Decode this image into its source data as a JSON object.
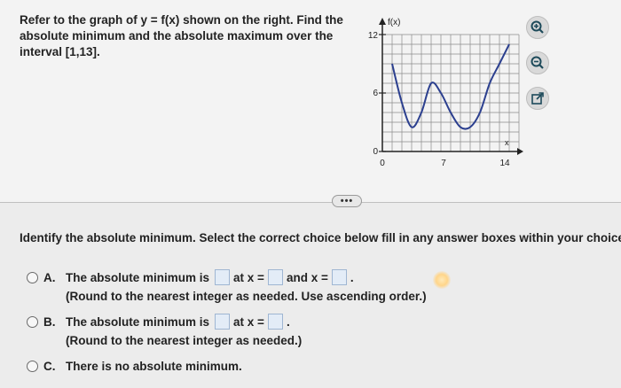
{
  "question": {
    "prompt_lines": [
      "Refer to the graph of y = f(x) shown on the right. Find the",
      "absolute minimum and the absolute maximum over the",
      "interval [1,13]."
    ]
  },
  "graph": {
    "y_axis_label": "f(x)",
    "x_axis_label": "x",
    "y_tick_labels": [
      "12",
      "6",
      "0"
    ],
    "x_tick_labels": [
      "0",
      "7",
      "14"
    ]
  },
  "chart_data": {
    "type": "line",
    "xlabel": "x",
    "ylabel": "f(x)",
    "xlim": [
      0,
      14
    ],
    "ylim": [
      0,
      12
    ],
    "grid": true,
    "x": [
      1,
      2,
      3,
      4,
      5,
      6,
      7,
      8,
      9,
      10,
      11,
      12,
      13
    ],
    "values": [
      9,
      5,
      2.5,
      4,
      7,
      6,
      4,
      2.5,
      2.5,
      4,
      7,
      9,
      11
    ]
  },
  "tools": {
    "zoom_in_icon": "zoom-in-icon",
    "zoom_out_icon": "zoom-out-icon",
    "popout_icon": "external-link-icon"
  },
  "more_button_label": "•••",
  "instruction": "Identify the absolute minimum. Select the correct choice below fill in any answer boxes within your choice.",
  "choices": {
    "a": {
      "letter": "A.",
      "text1": "The absolute minimum is",
      "text2": "at x =",
      "text3": "and x =",
      "text4": ".",
      "note": "(Round to the nearest integer as needed. Use ascending order.)"
    },
    "b": {
      "letter": "B.",
      "text1": "The absolute minimum is",
      "text2": "at x =",
      "text3": ".",
      "note": "(Round to the nearest integer as needed.)"
    },
    "c": {
      "letter": "C.",
      "text1": "There is no absolute minimum."
    }
  },
  "colors": {
    "curve": "#2b3f8f",
    "grid": "#8a8a8a",
    "answer_box": "#e3ecf7"
  }
}
